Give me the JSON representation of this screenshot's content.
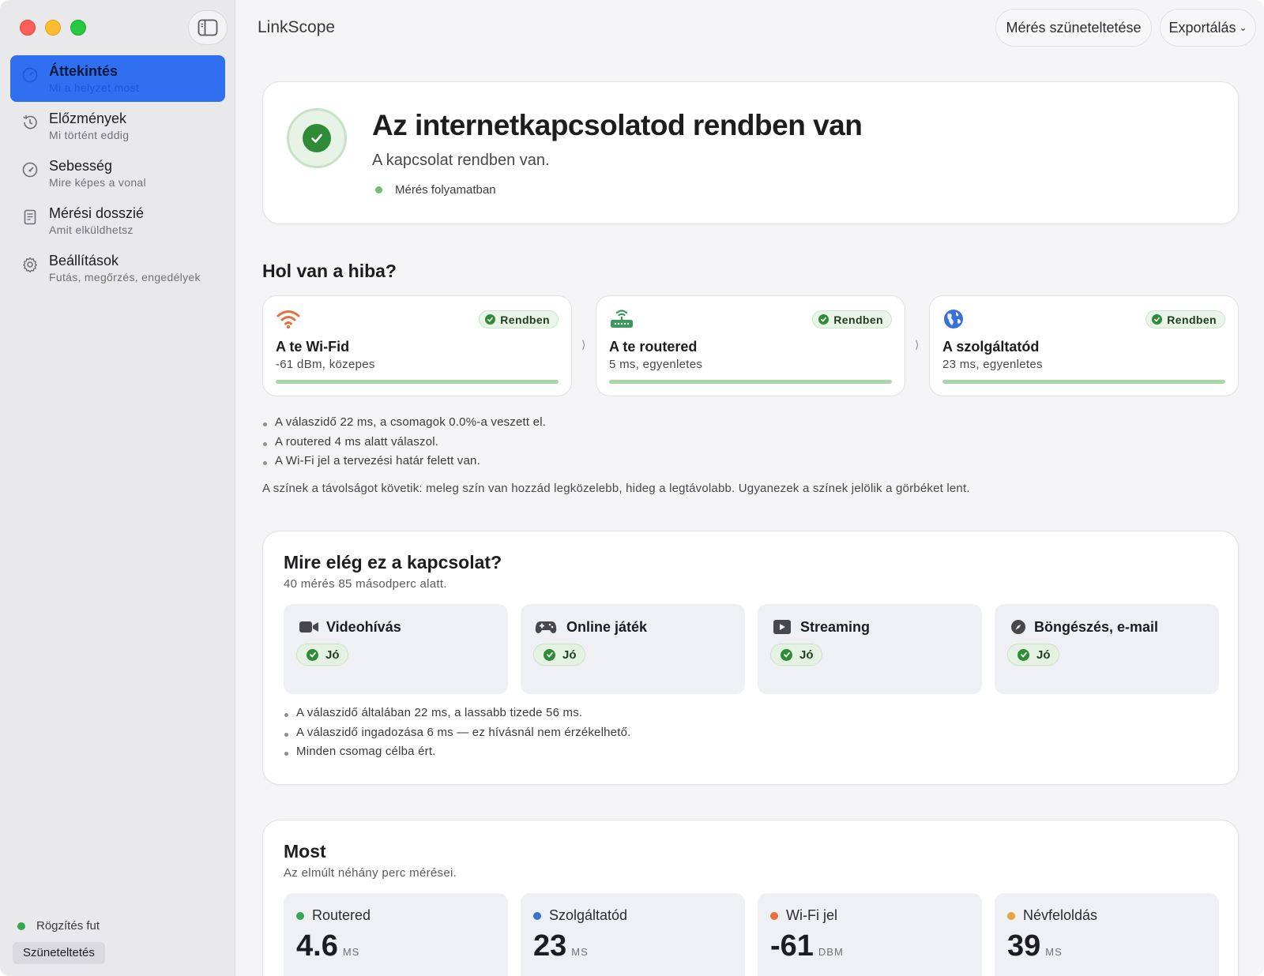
{
  "app": {
    "title": "LinkScope"
  },
  "toolbar": {
    "pause_label": "Mérés szüneteltetése",
    "export_label": "Exportálás"
  },
  "sidebar": {
    "items": [
      {
        "title": "Áttekintés",
        "subtitle": "Mi a helyzet most",
        "icon": "gauge-icon",
        "active": true
      },
      {
        "title": "Előzmények",
        "subtitle": "Mi történt eddig",
        "icon": "history-icon"
      },
      {
        "title": "Sebesség",
        "subtitle": "Mire képes a vonal",
        "icon": "speedometer-icon"
      },
      {
        "title": "Mérési dosszié",
        "subtitle": "Amit elküldhetsz",
        "icon": "document-icon"
      },
      {
        "title": "Beállítások",
        "subtitle": "Futás, megőrzés, engedélyek",
        "icon": "gear-icon"
      }
    ],
    "recording_status": "Rögzítés fut",
    "pause_button": "Szüneteltetés"
  },
  "hero": {
    "title": "Az internetkapcsolatod rendben van",
    "subtitle": "A kapcsolat rendben van.",
    "status": "Mérés folyamatban"
  },
  "diagnosis": {
    "title": "Hol van a hiba?",
    "segments": [
      {
        "title": "A te Wi-Fid",
        "detail": "-61 dBm, közepes",
        "badge": "Rendben",
        "icon": "wifi-icon",
        "color": "#e8703a"
      },
      {
        "title": "A te routered",
        "detail": "5 ms, egyenletes",
        "badge": "Rendben",
        "icon": "router-icon",
        "color": "#3a9a5b"
      },
      {
        "title": "A szolgáltatód",
        "detail": "23 ms, egyenletes",
        "badge": "Rendben",
        "icon": "globe-icon",
        "color": "#3a6fd8"
      }
    ],
    "bullets": [
      "A válaszidő 22 ms, a csomagok 0.0%-a veszett el.",
      "A routered 4 ms alatt válaszol.",
      "A Wi-Fi jel a tervezési határ felett van."
    ],
    "note": "A színek a távolságot követik: meleg szín van hozzád legközelebb, hideg a legtávolabb. Ugyanezek a színek jelölik a görbéket lent."
  },
  "usage": {
    "title": "Mire elég ez a kapcsolat?",
    "subtitle": "40 mérés 85 másodperc alatt.",
    "tiles": [
      {
        "title": "Videohívás",
        "rating": "Jó",
        "icon": "video-camera-icon"
      },
      {
        "title": "Online játék",
        "rating": "Jó",
        "icon": "gamepad-icon"
      },
      {
        "title": "Streaming",
        "rating": "Jó",
        "icon": "play-icon"
      },
      {
        "title": "Böngészés, e-mail",
        "rating": "Jó",
        "icon": "compass-icon"
      }
    ],
    "bullets": [
      "A válaszidő általában 22 ms, a lassabb tizede 56 ms.",
      "A válaszidő ingadozása 6 ms — ez hívásnál nem érzékelhető.",
      "Minden csomag célba ért."
    ]
  },
  "now": {
    "title": "Most",
    "subtitle": "Az elmúlt néhány perc mérései.",
    "metrics": [
      {
        "label": "Routered",
        "value": "4.6",
        "unit": "MS",
        "color": "#34a853"
      },
      {
        "label": "Szolgáltatód",
        "value": "23",
        "unit": "MS",
        "color": "#3a6fd8"
      },
      {
        "label": "Wi-Fi jel",
        "value": "-61",
        "unit": "DBM",
        "color": "#e8703a"
      },
      {
        "label": "Névfeloldás",
        "value": "39",
        "unit": "MS",
        "color": "#e8a23a"
      }
    ]
  },
  "colors": {
    "accent": "#2f6ff0",
    "ok": "#2e8b36"
  }
}
